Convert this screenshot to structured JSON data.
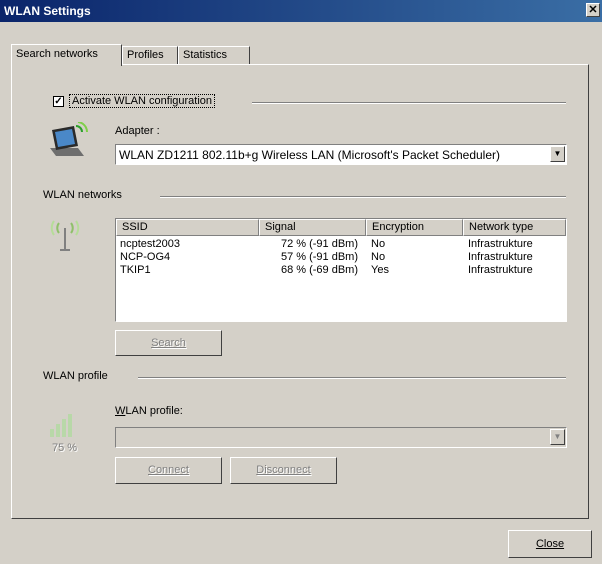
{
  "window": {
    "title": "WLAN Settings",
    "close_glyph": "✕"
  },
  "tabs": [
    {
      "label": "Search networks",
      "active": true
    },
    {
      "label": "Profiles",
      "active": false
    },
    {
      "label": "Statistics",
      "active": false
    }
  ],
  "activate": {
    "checked": true,
    "label": "Activate WLAN configuration"
  },
  "adapter": {
    "icon": "laptop-wireless-icon",
    "label": "Adapter :",
    "value": "WLAN ZD1211 802.11b+g Wireless LAN (Microsoft's Packet Scheduler)"
  },
  "networks": {
    "group_label": "WLAN networks",
    "icon": "antenna-icon",
    "columns": [
      "SSID",
      "Signal",
      "Encryption",
      "Network type"
    ],
    "rows": [
      {
        "ssid": "ncptest2003",
        "signal": "72 % (-91 dBm)",
        "encryption": "No",
        "type": "Infrastrukture"
      },
      {
        "ssid": "NCP-OG4",
        "signal": "57 % (-91 dBm)",
        "encryption": "No",
        "type": "Infrastrukture"
      },
      {
        "ssid": "TKIP1",
        "signal": "68 % (-69 dBm)",
        "encryption": "Yes",
        "type": "Infrastrukture"
      }
    ],
    "search_button": "Search"
  },
  "profile": {
    "group_label": "WLAN profile",
    "icon": "signal-strength-icon",
    "signal_percent": "75 %",
    "label": "WLAN profile:",
    "value": "",
    "connect_button": "Connect",
    "disconnect_button": "Disconnect"
  },
  "footer": {
    "close_button": "Close"
  }
}
